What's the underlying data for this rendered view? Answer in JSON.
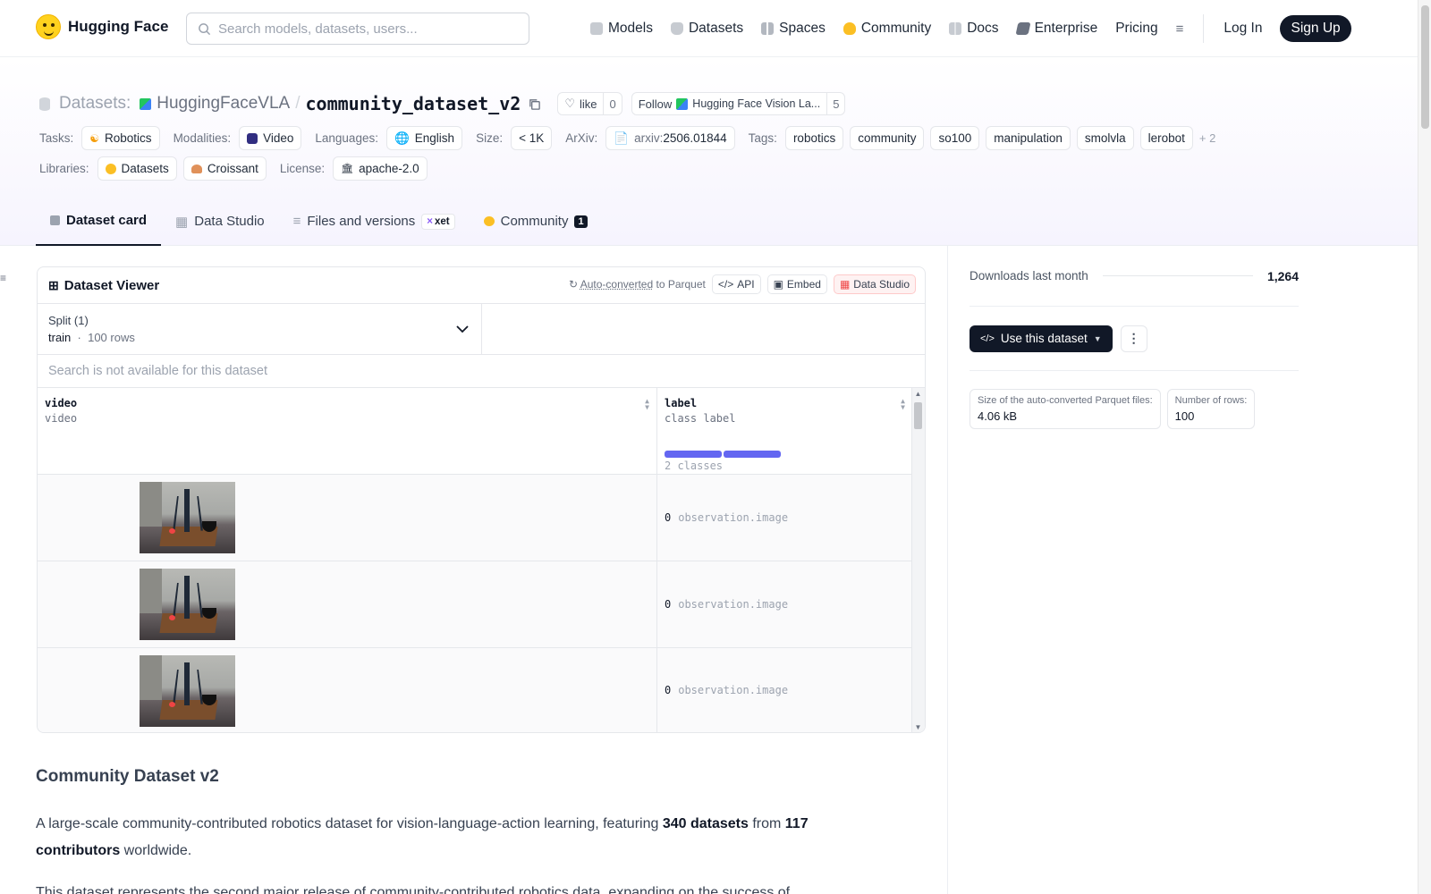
{
  "nav": {
    "brand": "Hugging Face",
    "search_placeholder": "Search models, datasets, users...",
    "links": [
      {
        "label": "Models",
        "icon": "cube-icon",
        "color": "#9ca3af"
      },
      {
        "label": "Datasets",
        "icon": "database-icon",
        "color": "#9ca3af"
      },
      {
        "label": "Spaces",
        "icon": "grid-icon",
        "color": "#9ca3af"
      },
      {
        "label": "Community",
        "icon": "hf-hands-icon",
        "color": "#fbbf24"
      },
      {
        "label": "Docs",
        "icon": "book-icon",
        "color": "#9ca3af"
      },
      {
        "label": "Enterprise",
        "icon": "briefcase-icon",
        "color": "#6b7280"
      },
      {
        "label": "Pricing"
      }
    ],
    "login": "Log In",
    "signup": "Sign Up"
  },
  "header": {
    "section": "Datasets:",
    "org": "HuggingFaceVLA",
    "name": "community_dataset_v2",
    "like_label": "like",
    "like_count": "0",
    "follow_label": "Follow",
    "follow_org": "Hugging Face Vision La...",
    "follow_count": "5",
    "tasks_label": "Tasks:",
    "task": "Robotics",
    "modalities_label": "Modalities:",
    "modality": "Video",
    "languages_label": "Languages:",
    "language": "English",
    "size_label": "Size:",
    "size": "< 1K",
    "arxiv_label": "ArXiv:",
    "arxiv_prefix": "arxiv:",
    "arxiv_id": "2506.01844",
    "tags_label": "Tags:",
    "tags": [
      "robotics",
      "community",
      "so100",
      "manipulation",
      "smolvla",
      "lerobot"
    ],
    "tags_more": "+ 2",
    "libraries_label": "Libraries:",
    "libraries": [
      "Datasets",
      "Croissant"
    ],
    "license_label": "License:",
    "license": "apache-2.0"
  },
  "tabs": [
    {
      "label": "Dataset card",
      "active": true
    },
    {
      "label": "Data Studio"
    },
    {
      "label": "Files and versions",
      "badge": "xet"
    },
    {
      "label": "Community",
      "count": "1"
    }
  ],
  "viewer": {
    "title": "Dataset Viewer",
    "auto_converted": "Auto-converted",
    "to_parquet": "to Parquet",
    "api": "API",
    "embed": "Embed",
    "data_studio": "Data Studio",
    "split_label": "Split (1)",
    "split_name": "train",
    "split_rows": "100 rows",
    "search_na": "Search is not available for this dataset",
    "columns": [
      {
        "name": "video",
        "type": "video"
      },
      {
        "name": "label",
        "type": "class label",
        "classes": "2 classes"
      }
    ],
    "rows": [
      {
        "label_id": "0",
        "label_name": "observation.image"
      },
      {
        "label_id": "0",
        "label_name": "observation.image"
      },
      {
        "label_id": "0",
        "label_name": "observation.image"
      }
    ]
  },
  "card": {
    "heading": "Community Dataset v2",
    "p1_a": "A large-scale community-contributed robotics dataset for vision-language-action learning, featuring ",
    "p1_b": "340 datasets",
    "p1_c": " from ",
    "p1_d": "117 contributors",
    "p1_e": " worldwide.",
    "p2": "This dataset represents the second major release of community-contributed robotics data, expanding on the success of"
  },
  "sidebar": {
    "downloads_label": "Downloads last month",
    "downloads": "1,264",
    "use_button": "Use this dataset",
    "parquet_size_label": "Size of the auto-converted Parquet files:",
    "parquet_size": "4.06 kB",
    "rows_label": "Number of rows:",
    "rows": "100"
  }
}
